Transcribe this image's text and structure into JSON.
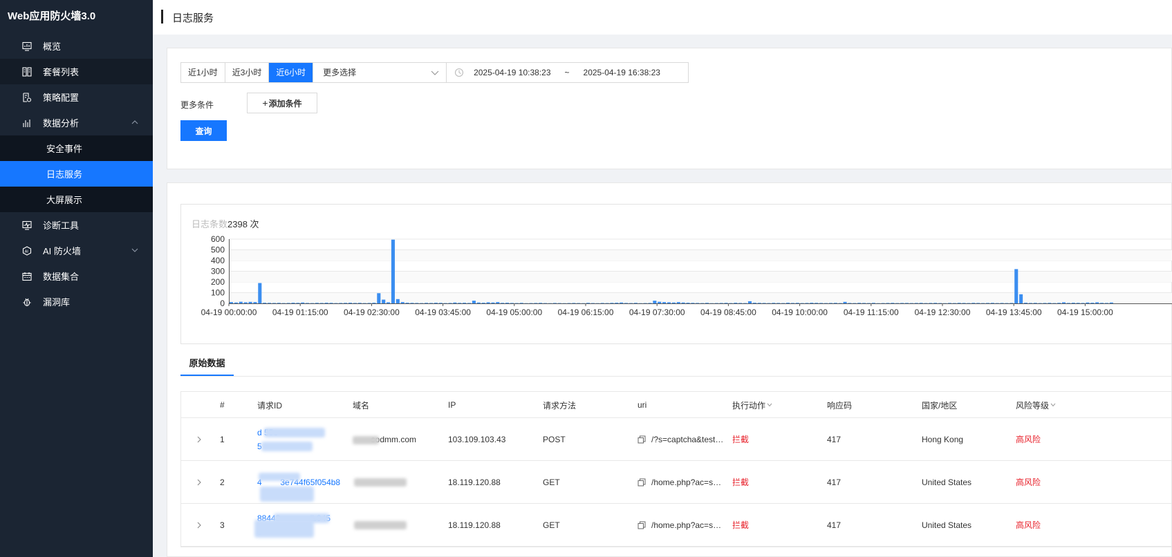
{
  "app": {
    "title": "Web应用防火墙3.0"
  },
  "sidebar": {
    "items": [
      {
        "label": "概览",
        "icon": "monitor-icon"
      },
      {
        "label": "套餐列表",
        "icon": "list-icon"
      },
      {
        "label": "策略配置",
        "icon": "policy-icon"
      },
      {
        "label": "数据分析",
        "icon": "chart-icon",
        "expanded": true,
        "children": [
          {
            "label": "安全事件"
          },
          {
            "label": "日志服务",
            "active": true
          },
          {
            "label": "大屏展示"
          }
        ]
      },
      {
        "label": "诊断工具",
        "icon": "diagnose-icon"
      },
      {
        "label": "AI 防火墙",
        "icon": "ai-icon",
        "expanded": false
      },
      {
        "label": "数据集合",
        "icon": "calendar-icon"
      },
      {
        "label": "漏洞库",
        "icon": "bug-icon"
      }
    ]
  },
  "header": {
    "title": "日志服务"
  },
  "filter": {
    "ranges": [
      "近1小时",
      "近3小时",
      "近6小时"
    ],
    "active_range": "近6小时",
    "more_select": "更多选择",
    "start_time": "2025-04-19 10:38:23",
    "separator": "~",
    "end_time": "2025-04-19 16:38:23",
    "more_conditions_label": "更多条件",
    "add_condition_label": "添加条件",
    "add_condition_plus": "+",
    "query_label": "查询"
  },
  "chart_header": {
    "label": "日志条数",
    "count": "2398 次"
  },
  "chart_data": {
    "type": "bar",
    "title": "日志条数2398 次",
    "ylim": [
      0,
      600
    ],
    "yticks": [
      0,
      100,
      200,
      300,
      400,
      500,
      600
    ],
    "xtick_labels": [
      "04-19 00:00:00",
      "04-19 01:15:00",
      "04-19 02:30:00",
      "04-19 03:45:00",
      "04-19 05:00:00",
      "04-19 06:15:00",
      "04-19 07:30:00",
      "04-19 08:45:00",
      "04-19 10:00:00",
      "04-19 11:15:00",
      "04-19 12:30:00",
      "04-19 13:45:00",
      "04-19 15:00:00"
    ],
    "interval_minutes": 5,
    "start": "04-19 00:00:00",
    "values": [
      12,
      8,
      15,
      10,
      14,
      12,
      190,
      6,
      5,
      4,
      5,
      3,
      4,
      6,
      5,
      8,
      4,
      3,
      5,
      4,
      6,
      5,
      3,
      4,
      5,
      6,
      4,
      5,
      3,
      4,
      6,
      95,
      35,
      10,
      595,
      40,
      12,
      6,
      5,
      4,
      3,
      5,
      4,
      6,
      5,
      3,
      4,
      8,
      5,
      6,
      4,
      25,
      8,
      6,
      10,
      8,
      12,
      5,
      6,
      4,
      3,
      5,
      2,
      3,
      4,
      5,
      3,
      2,
      4,
      3,
      2,
      3,
      4,
      3,
      2,
      5,
      3,
      2,
      4,
      3,
      5,
      6,
      8,
      4,
      3,
      5,
      2,
      3,
      4,
      25,
      15,
      12,
      10,
      8,
      12,
      8,
      6,
      5,
      4,
      3,
      5,
      2,
      3,
      4,
      5,
      3,
      6,
      4,
      3,
      20,
      6,
      5,
      4,
      3,
      5,
      4,
      3,
      6,
      4,
      5,
      3,
      4,
      6,
      5,
      4,
      3,
      4,
      5,
      3,
      14,
      4,
      3,
      5,
      4,
      3,
      5,
      2,
      3,
      4,
      5,
      3,
      4,
      4,
      3,
      4,
      5,
      3,
      4,
      5,
      3,
      2,
      4,
      3,
      5,
      4,
      3,
      5,
      4,
      3,
      4,
      5,
      3,
      4,
      3,
      4,
      320,
      85,
      6,
      4,
      5,
      3,
      4,
      5,
      3,
      5,
      10,
      4,
      6,
      5,
      4,
      8,
      6,
      10,
      5,
      4,
      8
    ]
  },
  "tabs": [
    {
      "label": "原始数据",
      "active": true
    }
  ],
  "table": {
    "headers": {
      "index": "#",
      "request_id": "请求ID",
      "domain": "域名",
      "ip": "IP",
      "method": "请求方法",
      "uri": "uri",
      "action": "执行动作",
      "status": "响应码",
      "country": "国家/地区",
      "risk": "风险等级"
    },
    "rows": [
      {
        "index": "1",
        "id_line1": "d                   55c",
        "id_line2": "5",
        "domain": "        sodmm.com",
        "ip": "103.109.103.43",
        "method": "POST",
        "uri": "/?s=captcha&test…",
        "action": "拦截",
        "status": "417",
        "country": "Hong Kong",
        "risk": "高风险"
      },
      {
        "index": "2",
        "id_line1": "4        3e744f65f054b8",
        "id_line2": "",
        "domain": "",
        "ip": "18.119.120.88",
        "method": "GET",
        "uri": "/home.php?ac=s…",
        "action": "拦截",
        "status": "417",
        "country": "United States",
        "risk": "高风险"
      },
      {
        "index": "3",
        "id_line1": "88443             lb945",
        "id_line2": "e",
        "domain": "",
        "ip": "18.119.120.88",
        "method": "GET",
        "uri": "/home.php?ac=s…",
        "action": "拦截",
        "status": "417",
        "country": "United States",
        "risk": "高风险"
      }
    ]
  },
  "colors": {
    "sidebar_bg": "#1b2533",
    "accent": "#1677ff",
    "danger": "#e8222c",
    "bar": "#3b8ef0"
  }
}
